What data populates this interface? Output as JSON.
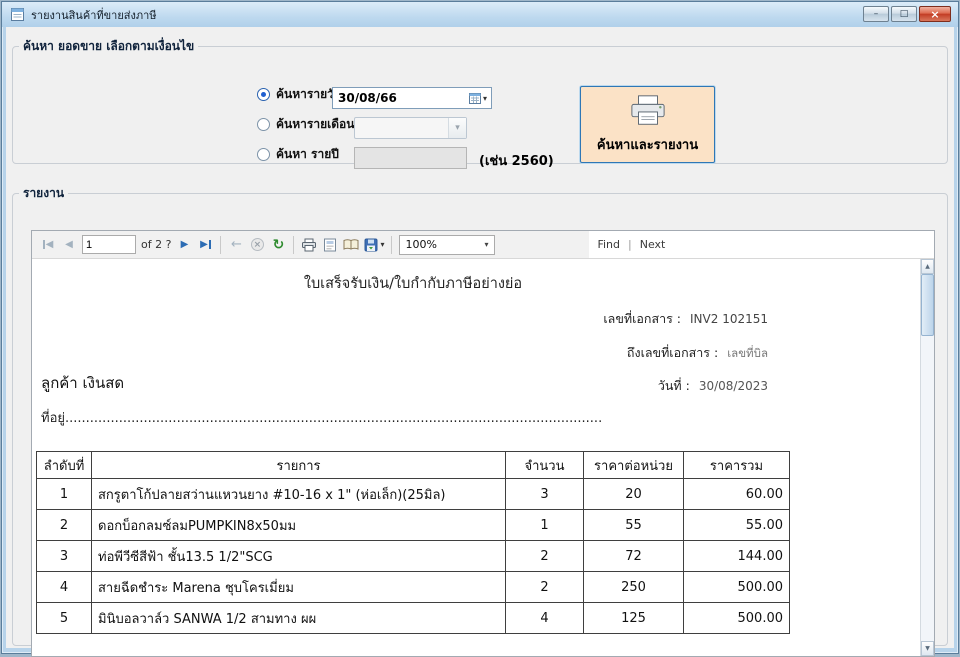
{
  "window": {
    "title": "รายงานสินค้าที่ขายส่งภาษี"
  },
  "icons": {
    "minimize": "–",
    "maximize": "□",
    "close": "×",
    "prev": "◀",
    "next": "▶",
    "back": "←",
    "stop": "×",
    "refresh": "↻",
    "dropdown": "▾",
    "scroll_up": "▲",
    "scroll_down": "▼"
  },
  "search": {
    "group_title": "ค้นหา ยอดขาย เลือกตามเงื่อนไข",
    "daily_label": "ค้นหารายวัน",
    "monthly_label": "ค้นหารายเดือน",
    "yearly_label": "ค้นหา รายปี",
    "date_value": "30/08/66",
    "month_value": "",
    "year_value": "",
    "year_hint": "(เช่น 2560)",
    "search_button_label": "ค้นหาและรายงาน"
  },
  "report": {
    "group_title": "รายงาน",
    "toolbar": {
      "page_value": "1",
      "page_total_label": "of 2 ?",
      "zoom_value": "100%",
      "find_label": "Find",
      "find_separator": "|",
      "next_label": "Next"
    },
    "document": {
      "title": "ใบเสร็จรับเงิน/ใบกำกับภาษีอย่างย่อ",
      "doc_no_label": "เลขที่เอกสาร :",
      "doc_no_value": "INV2 102151",
      "to_doc_label": "ถึงเลขที่เอกสาร :",
      "to_doc_value": "เลขที่บิล",
      "date_label": "วันที่ :",
      "date_value": "30/08/2023",
      "customer_line": "ลูกค้า  เงินสด",
      "address_line": "ที่อยู่.........................................................................................................................................................................",
      "table": {
        "headers": [
          "ลำดับที่",
          "รายการ",
          "จำนวน",
          "ราคาต่อหน่วย",
          "ราคารวม"
        ],
        "rows": [
          [
            "1",
            "สกรูตาโก้ปลายสว่านแหวนยาง #10-16 x 1\" (ห่อเล็ก)(25มิล)",
            "3",
            "20",
            "60.00"
          ],
          [
            "2",
            "ดอกบ็อกลมซ์ลมPUMPKIN8x50มม",
            "1",
            "55",
            "55.00"
          ],
          [
            "3",
            "ท่อพีวีซีสีฟ้า ชั้น13.5 1/2\"SCG",
            "2",
            "72",
            "144.00"
          ],
          [
            "4",
            "สายฉีดชำระ Marena ชุบโครเมี่ยม",
            "2",
            "250",
            "500.00"
          ],
          [
            "5",
            "มินิบอลวาล์ว SANWA 1/2 สามทาง ผผ",
            "4",
            "125",
            "500.00"
          ]
        ]
      }
    }
  },
  "colors": {
    "accent_blue": "#2c6cb4",
    "button_peach": "#fbe2c6",
    "titlebar_blue": "#bed9ef",
    "close_red": "#c23c24"
  }
}
